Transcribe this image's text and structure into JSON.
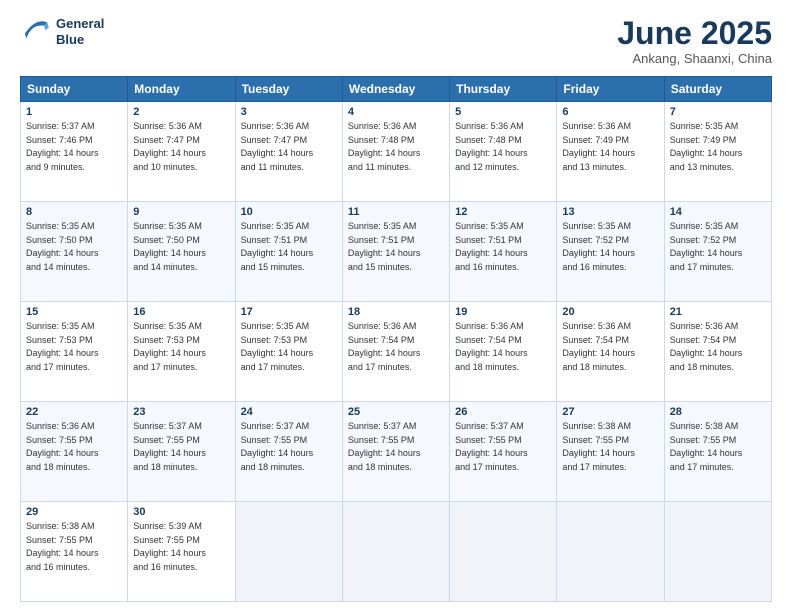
{
  "logo": {
    "line1": "General",
    "line2": "Blue"
  },
  "title": "June 2025",
  "location": "Ankang, Shaanxi, China",
  "headers": [
    "Sunday",
    "Monday",
    "Tuesday",
    "Wednesday",
    "Thursday",
    "Friday",
    "Saturday"
  ],
  "weeks": [
    [
      {
        "day": "1",
        "sunrise": "5:37 AM",
        "sunset": "7:46 PM",
        "daylight": "14 hours and 9 minutes."
      },
      {
        "day": "2",
        "sunrise": "5:36 AM",
        "sunset": "7:47 PM",
        "daylight": "14 hours and 10 minutes."
      },
      {
        "day": "3",
        "sunrise": "5:36 AM",
        "sunset": "7:47 PM",
        "daylight": "14 hours and 11 minutes."
      },
      {
        "day": "4",
        "sunrise": "5:36 AM",
        "sunset": "7:48 PM",
        "daylight": "14 hours and 11 minutes."
      },
      {
        "day": "5",
        "sunrise": "5:36 AM",
        "sunset": "7:48 PM",
        "daylight": "14 hours and 12 minutes."
      },
      {
        "day": "6",
        "sunrise": "5:36 AM",
        "sunset": "7:49 PM",
        "daylight": "14 hours and 13 minutes."
      },
      {
        "day": "7",
        "sunrise": "5:35 AM",
        "sunset": "7:49 PM",
        "daylight": "14 hours and 13 minutes."
      }
    ],
    [
      {
        "day": "8",
        "sunrise": "5:35 AM",
        "sunset": "7:50 PM",
        "daylight": "14 hours and 14 minutes."
      },
      {
        "day": "9",
        "sunrise": "5:35 AM",
        "sunset": "7:50 PM",
        "daylight": "14 hours and 14 minutes."
      },
      {
        "day": "10",
        "sunrise": "5:35 AM",
        "sunset": "7:51 PM",
        "daylight": "14 hours and 15 minutes."
      },
      {
        "day": "11",
        "sunrise": "5:35 AM",
        "sunset": "7:51 PM",
        "daylight": "14 hours and 15 minutes."
      },
      {
        "day": "12",
        "sunrise": "5:35 AM",
        "sunset": "7:51 PM",
        "daylight": "14 hours and 16 minutes."
      },
      {
        "day": "13",
        "sunrise": "5:35 AM",
        "sunset": "7:52 PM",
        "daylight": "14 hours and 16 minutes."
      },
      {
        "day": "14",
        "sunrise": "5:35 AM",
        "sunset": "7:52 PM",
        "daylight": "14 hours and 17 minutes."
      }
    ],
    [
      {
        "day": "15",
        "sunrise": "5:35 AM",
        "sunset": "7:53 PM",
        "daylight": "14 hours and 17 minutes."
      },
      {
        "day": "16",
        "sunrise": "5:35 AM",
        "sunset": "7:53 PM",
        "daylight": "14 hours and 17 minutes."
      },
      {
        "day": "17",
        "sunrise": "5:35 AM",
        "sunset": "7:53 PM",
        "daylight": "14 hours and 17 minutes."
      },
      {
        "day": "18",
        "sunrise": "5:36 AM",
        "sunset": "7:54 PM",
        "daylight": "14 hours and 17 minutes."
      },
      {
        "day": "19",
        "sunrise": "5:36 AM",
        "sunset": "7:54 PM",
        "daylight": "14 hours and 18 minutes."
      },
      {
        "day": "20",
        "sunrise": "5:36 AM",
        "sunset": "7:54 PM",
        "daylight": "14 hours and 18 minutes."
      },
      {
        "day": "21",
        "sunrise": "5:36 AM",
        "sunset": "7:54 PM",
        "daylight": "14 hours and 18 minutes."
      }
    ],
    [
      {
        "day": "22",
        "sunrise": "5:36 AM",
        "sunset": "7:55 PM",
        "daylight": "14 hours and 18 minutes."
      },
      {
        "day": "23",
        "sunrise": "5:37 AM",
        "sunset": "7:55 PM",
        "daylight": "14 hours and 18 minutes."
      },
      {
        "day": "24",
        "sunrise": "5:37 AM",
        "sunset": "7:55 PM",
        "daylight": "14 hours and 18 minutes."
      },
      {
        "day": "25",
        "sunrise": "5:37 AM",
        "sunset": "7:55 PM",
        "daylight": "14 hours and 18 minutes."
      },
      {
        "day": "26",
        "sunrise": "5:37 AM",
        "sunset": "7:55 PM",
        "daylight": "14 hours and 17 minutes."
      },
      {
        "day": "27",
        "sunrise": "5:38 AM",
        "sunset": "7:55 PM",
        "daylight": "14 hours and 17 minutes."
      },
      {
        "day": "28",
        "sunrise": "5:38 AM",
        "sunset": "7:55 PM",
        "daylight": "14 hours and 17 minutes."
      }
    ],
    [
      {
        "day": "29",
        "sunrise": "5:38 AM",
        "sunset": "7:55 PM",
        "daylight": "14 hours and 16 minutes."
      },
      {
        "day": "30",
        "sunrise": "5:39 AM",
        "sunset": "7:55 PM",
        "daylight": "14 hours and 16 minutes."
      },
      null,
      null,
      null,
      null,
      null
    ]
  ]
}
